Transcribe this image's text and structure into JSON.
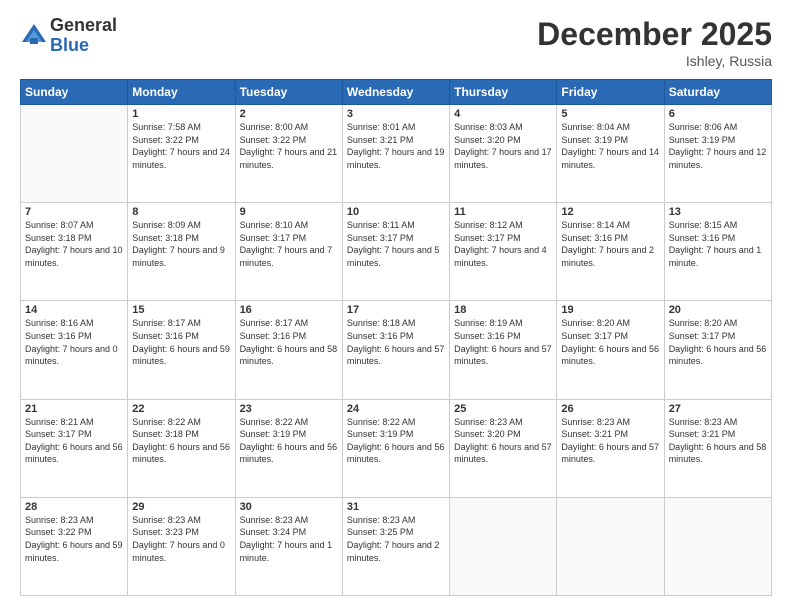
{
  "logo": {
    "general": "General",
    "blue": "Blue"
  },
  "header": {
    "month": "December 2025",
    "location": "Ishley, Russia"
  },
  "weekdays": [
    "Sunday",
    "Monday",
    "Tuesday",
    "Wednesday",
    "Thursday",
    "Friday",
    "Saturday"
  ],
  "weeks": [
    [
      {
        "day": "",
        "empty": true
      },
      {
        "day": "1",
        "sunrise": "Sunrise: 7:58 AM",
        "sunset": "Sunset: 3:22 PM",
        "daylight": "Daylight: 7 hours and 24 minutes."
      },
      {
        "day": "2",
        "sunrise": "Sunrise: 8:00 AM",
        "sunset": "Sunset: 3:22 PM",
        "daylight": "Daylight: 7 hours and 21 minutes."
      },
      {
        "day": "3",
        "sunrise": "Sunrise: 8:01 AM",
        "sunset": "Sunset: 3:21 PM",
        "daylight": "Daylight: 7 hours and 19 minutes."
      },
      {
        "day": "4",
        "sunrise": "Sunrise: 8:03 AM",
        "sunset": "Sunset: 3:20 PM",
        "daylight": "Daylight: 7 hours and 17 minutes."
      },
      {
        "day": "5",
        "sunrise": "Sunrise: 8:04 AM",
        "sunset": "Sunset: 3:19 PM",
        "daylight": "Daylight: 7 hours and 14 minutes."
      },
      {
        "day": "6",
        "sunrise": "Sunrise: 8:06 AM",
        "sunset": "Sunset: 3:19 PM",
        "daylight": "Daylight: 7 hours and 12 minutes."
      }
    ],
    [
      {
        "day": "7",
        "sunrise": "Sunrise: 8:07 AM",
        "sunset": "Sunset: 3:18 PM",
        "daylight": "Daylight: 7 hours and 10 minutes."
      },
      {
        "day": "8",
        "sunrise": "Sunrise: 8:09 AM",
        "sunset": "Sunset: 3:18 PM",
        "daylight": "Daylight: 7 hours and 9 minutes."
      },
      {
        "day": "9",
        "sunrise": "Sunrise: 8:10 AM",
        "sunset": "Sunset: 3:17 PM",
        "daylight": "Daylight: 7 hours and 7 minutes."
      },
      {
        "day": "10",
        "sunrise": "Sunrise: 8:11 AM",
        "sunset": "Sunset: 3:17 PM",
        "daylight": "Daylight: 7 hours and 5 minutes."
      },
      {
        "day": "11",
        "sunrise": "Sunrise: 8:12 AM",
        "sunset": "Sunset: 3:17 PM",
        "daylight": "Daylight: 7 hours and 4 minutes."
      },
      {
        "day": "12",
        "sunrise": "Sunrise: 8:14 AM",
        "sunset": "Sunset: 3:16 PM",
        "daylight": "Daylight: 7 hours and 2 minutes."
      },
      {
        "day": "13",
        "sunrise": "Sunrise: 8:15 AM",
        "sunset": "Sunset: 3:16 PM",
        "daylight": "Daylight: 7 hours and 1 minute."
      }
    ],
    [
      {
        "day": "14",
        "sunrise": "Sunrise: 8:16 AM",
        "sunset": "Sunset: 3:16 PM",
        "daylight": "Daylight: 7 hours and 0 minutes."
      },
      {
        "day": "15",
        "sunrise": "Sunrise: 8:17 AM",
        "sunset": "Sunset: 3:16 PM",
        "daylight": "Daylight: 6 hours and 59 minutes."
      },
      {
        "day": "16",
        "sunrise": "Sunrise: 8:17 AM",
        "sunset": "Sunset: 3:16 PM",
        "daylight": "Daylight: 6 hours and 58 minutes."
      },
      {
        "day": "17",
        "sunrise": "Sunrise: 8:18 AM",
        "sunset": "Sunset: 3:16 PM",
        "daylight": "Daylight: 6 hours and 57 minutes."
      },
      {
        "day": "18",
        "sunrise": "Sunrise: 8:19 AM",
        "sunset": "Sunset: 3:16 PM",
        "daylight": "Daylight: 6 hours and 57 minutes."
      },
      {
        "day": "19",
        "sunrise": "Sunrise: 8:20 AM",
        "sunset": "Sunset: 3:17 PM",
        "daylight": "Daylight: 6 hours and 56 minutes."
      },
      {
        "day": "20",
        "sunrise": "Sunrise: 8:20 AM",
        "sunset": "Sunset: 3:17 PM",
        "daylight": "Daylight: 6 hours and 56 minutes."
      }
    ],
    [
      {
        "day": "21",
        "sunrise": "Sunrise: 8:21 AM",
        "sunset": "Sunset: 3:17 PM",
        "daylight": "Daylight: 6 hours and 56 minutes."
      },
      {
        "day": "22",
        "sunrise": "Sunrise: 8:22 AM",
        "sunset": "Sunset: 3:18 PM",
        "daylight": "Daylight: 6 hours and 56 minutes."
      },
      {
        "day": "23",
        "sunrise": "Sunrise: 8:22 AM",
        "sunset": "Sunset: 3:19 PM",
        "daylight": "Daylight: 6 hours and 56 minutes."
      },
      {
        "day": "24",
        "sunrise": "Sunrise: 8:22 AM",
        "sunset": "Sunset: 3:19 PM",
        "daylight": "Daylight: 6 hours and 56 minutes."
      },
      {
        "day": "25",
        "sunrise": "Sunrise: 8:23 AM",
        "sunset": "Sunset: 3:20 PM",
        "daylight": "Daylight: 6 hours and 57 minutes."
      },
      {
        "day": "26",
        "sunrise": "Sunrise: 8:23 AM",
        "sunset": "Sunset: 3:21 PM",
        "daylight": "Daylight: 6 hours and 57 minutes."
      },
      {
        "day": "27",
        "sunrise": "Sunrise: 8:23 AM",
        "sunset": "Sunset: 3:21 PM",
        "daylight": "Daylight: 6 hours and 58 minutes."
      }
    ],
    [
      {
        "day": "28",
        "sunrise": "Sunrise: 8:23 AM",
        "sunset": "Sunset: 3:22 PM",
        "daylight": "Daylight: 6 hours and 59 minutes."
      },
      {
        "day": "29",
        "sunrise": "Sunrise: 8:23 AM",
        "sunset": "Sunset: 3:23 PM",
        "daylight": "Daylight: 7 hours and 0 minutes."
      },
      {
        "day": "30",
        "sunrise": "Sunrise: 8:23 AM",
        "sunset": "Sunset: 3:24 PM",
        "daylight": "Daylight: 7 hours and 1 minute."
      },
      {
        "day": "31",
        "sunrise": "Sunrise: 8:23 AM",
        "sunset": "Sunset: 3:25 PM",
        "daylight": "Daylight: 7 hours and 2 minutes."
      },
      {
        "day": "",
        "empty": true
      },
      {
        "day": "",
        "empty": true
      },
      {
        "day": "",
        "empty": true
      }
    ]
  ]
}
